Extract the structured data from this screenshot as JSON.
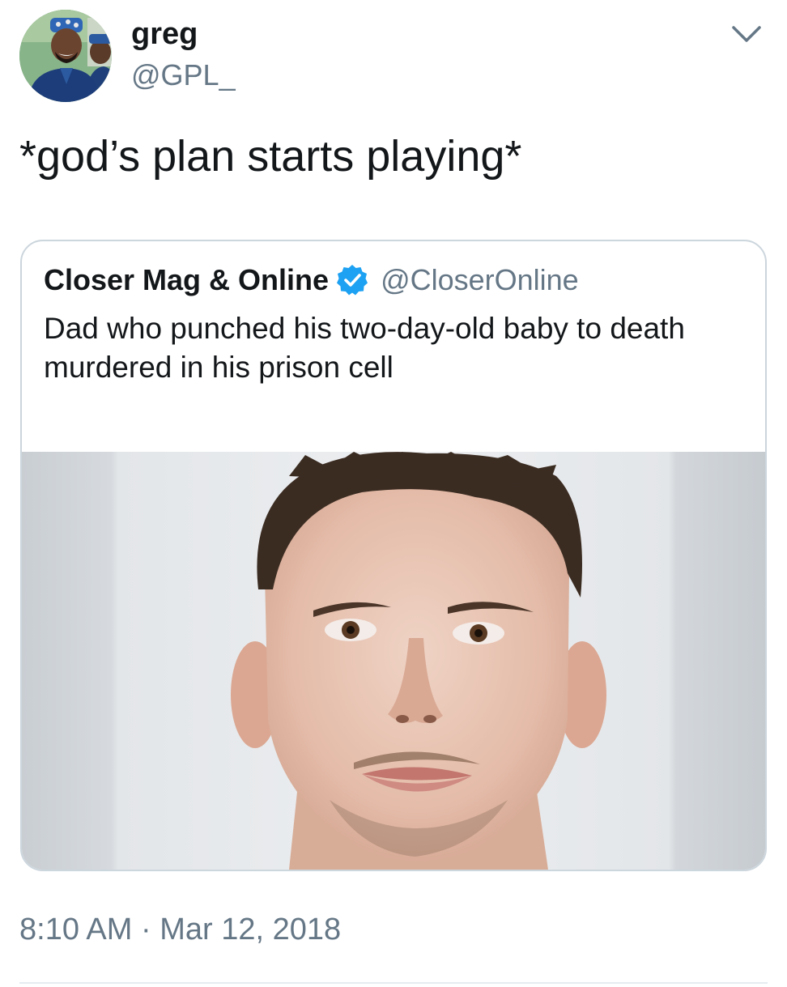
{
  "tweet": {
    "author": {
      "display_name": "greg",
      "handle": "@GPL_",
      "avatar_icon": "profile-photo"
    },
    "menu_icon": "chevron-down-icon",
    "text": "*god’s plan starts playing*",
    "timestamp": {
      "time": "8:10 AM",
      "separator": "·",
      "date": "Mar 12, 2018"
    }
  },
  "quoted_tweet": {
    "author_name": "Closer Mag & Online",
    "verified_icon": "verified-badge-icon",
    "author_handle": "@CloserOnline",
    "text": "Dad who punched his two-day-old baby to death murdered in his prison cell",
    "media": "mugshot-photo"
  },
  "colors": {
    "text_primary": "#14171a",
    "text_secondary": "#657786",
    "border": "#ccd6dd",
    "verified_blue": "#1da1f2",
    "divider": "#e6ecf0"
  }
}
